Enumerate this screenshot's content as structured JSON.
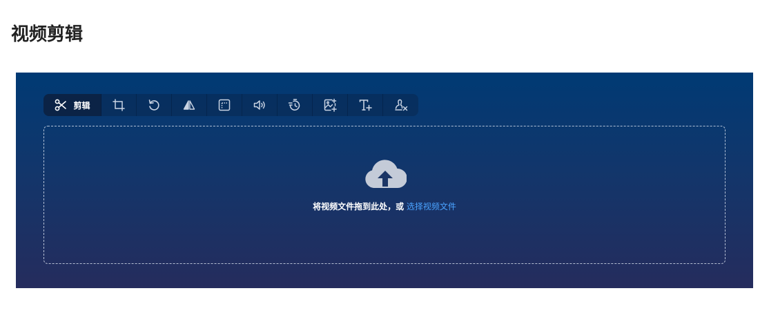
{
  "page": {
    "title": "视频剪辑"
  },
  "toolbar": {
    "items": [
      {
        "icon": "scissors-icon",
        "label": "剪辑",
        "active": true
      },
      {
        "icon": "crop-icon",
        "label": ""
      },
      {
        "icon": "rotate-icon",
        "label": ""
      },
      {
        "icon": "flip-icon",
        "label": ""
      },
      {
        "icon": "frame-icon",
        "label": ""
      },
      {
        "icon": "volume-icon",
        "label": ""
      },
      {
        "icon": "speed-icon",
        "label": ""
      },
      {
        "icon": "add-image-icon",
        "label": ""
      },
      {
        "icon": "add-text-icon",
        "label": ""
      },
      {
        "icon": "remove-watermark-icon",
        "label": ""
      }
    ]
  },
  "dropzone": {
    "icon": "cloud-upload-icon",
    "prompt": "将视频文件拖到此处，或",
    "link": "选择视频文件"
  },
  "colors": {
    "gradient_top": "#003a74",
    "gradient_bottom": "#252c5d",
    "link": "#4aa3ff",
    "title": "#222222"
  }
}
